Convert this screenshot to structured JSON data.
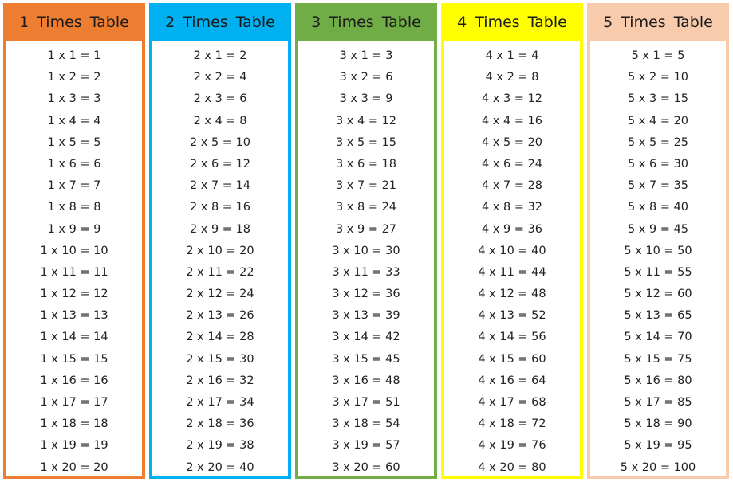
{
  "tables": [
    {
      "title": "1 Times Table",
      "color": "#ed7d31",
      "rows": [
        "1 x 1 = 1",
        "1 x 2 = 2",
        "1 x 3 = 3",
        "1 x 4 = 4",
        "1 x 5 = 5",
        "1 x 6 = 6",
        "1 x 7 = 7",
        "1 x 8 = 8",
        "1 x 9 = 9",
        "1 x 10 = 10",
        "1 x 11 = 11",
        "1 x 12 = 12",
        "1 x 13 = 13",
        "1 x 14 = 14",
        "1 x 15 = 15",
        "1 x 16 = 16",
        "1 x 17 = 17",
        "1 x 18 = 18",
        "1 x 19 = 19",
        "1 x 20 = 20"
      ]
    },
    {
      "title": "2 Times Table",
      "color": "#00b0f0",
      "rows": [
        "2 x 1 = 2",
        "2 x 2 = 4",
        "2 x 3 = 6",
        "2 x 4 = 8",
        "2 x 5 = 10",
        "2 x 6 = 12",
        "2 x 7 = 14",
        "2 x 8 = 16",
        "2 x 9 = 18",
        "2 x 10 = 20",
        "2 x 11 = 22",
        "2 x 12 = 24",
        "2 x 13 = 26",
        "2 x 14 = 28",
        "2 x 15 = 30",
        "2 x 16 = 32",
        "2 x 17 = 34",
        "2 x 18 = 36",
        "2 x 19 = 38",
        "2 x 20 = 40"
      ]
    },
    {
      "title": "3 Times Table",
      "color": "#70ad47",
      "rows": [
        "3 x 1 = 3",
        "3 x 2 = 6",
        "3 x 3 = 9",
        "3 x 4 = 12",
        "3 x 5 = 15",
        "3 x 6 = 18",
        "3 x 7 = 21",
        "3 x 8 = 24",
        "3 x 9 = 27",
        "3 x 10 = 30",
        "3 x 11 = 33",
        "3 x 12 = 36",
        "3 x 13 = 39",
        "3 x 14 = 42",
        "3 x 15 = 45",
        "3 x 16 = 48",
        "3 x 17 = 51",
        "3 x 18 = 54",
        "3 x 19 = 57",
        "3 x 20 = 60"
      ]
    },
    {
      "title": "4 Times Table",
      "color": "#ffff00",
      "rows": [
        "4 x 1 = 4",
        "4 x 2 = 8",
        "4 x 3 = 12",
        "4 x 4 = 16",
        "4 x 5 = 20",
        "4 x 6 = 24",
        "4 x 7 = 28",
        "4 x 8 = 32",
        "4 x 9 = 36",
        "4 x 10 = 40",
        "4 x 11 = 44",
        "4 x 12 = 48",
        "4 x 13 = 52",
        "4 x 14 = 56",
        "4 x 15 = 60",
        "4 x 16 = 64",
        "4 x 17 = 68",
        "4 x 18 = 72",
        "4 x 19 = 76",
        "4 x 20 = 80"
      ]
    },
    {
      "title": "5 Times Table",
      "color": "#f8cbad",
      "rows": [
        "5 x 1 = 5",
        "5 x 2 = 10",
        "5 x 3 = 15",
        "5 x 4 = 20",
        "5 x 5 = 25",
        "5 x 6 = 30",
        "5 x 7 = 35",
        "5 x 8 = 40",
        "5 x 9 = 45",
        "5 x 10 = 50",
        "5 x 11 = 55",
        "5 x 12 = 60",
        "5 x 13 = 65",
        "5 x 14 = 70",
        "5 x 15 = 75",
        "5 x 16 = 80",
        "5 x 17 = 85",
        "5 x 18 = 90",
        "5 x 19 = 95",
        "5 x 20 = 100"
      ]
    }
  ]
}
